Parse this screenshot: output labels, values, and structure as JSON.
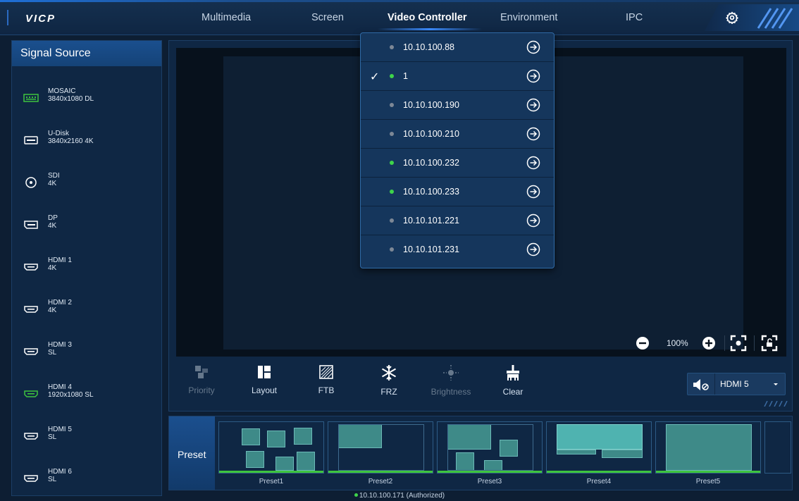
{
  "app": {
    "logo": "VICP"
  },
  "nav": {
    "items": [
      {
        "label": "Multimedia",
        "active": false
      },
      {
        "label": "Screen",
        "active": false
      },
      {
        "label": "Video Controller",
        "active": true
      },
      {
        "label": "Environment",
        "active": false
      },
      {
        "label": "IPC",
        "active": false
      }
    ],
    "settings_icon": "gear-icon"
  },
  "sidebar": {
    "title": "Signal Source",
    "items": [
      {
        "name": "MOSAIC",
        "res": "3840x1080 DL",
        "icon": "mosaic-icon",
        "active": true
      },
      {
        "name": "U-Disk",
        "res": "3840x2160 4K",
        "icon": "usb-icon",
        "active": false
      },
      {
        "name": "SDI",
        "res": "4K",
        "icon": "sdi-icon",
        "active": false
      },
      {
        "name": "DP",
        "res": "4K",
        "icon": "dp-icon",
        "active": false
      },
      {
        "name": "HDMI 1",
        "res": "4K",
        "icon": "hdmi-icon",
        "active": false
      },
      {
        "name": "HDMI 2",
        "res": "4K",
        "icon": "hdmi-icon",
        "active": false
      },
      {
        "name": "HDMI 3",
        "res": "SL",
        "icon": "hdmi-icon",
        "active": false
      },
      {
        "name": "HDMI 4",
        "res": "1920x1080 SL",
        "icon": "hdmi-icon",
        "active": true
      },
      {
        "name": "HDMI 5",
        "res": "SL",
        "icon": "hdmi-icon",
        "active": false
      },
      {
        "name": "HDMI 6",
        "res": "SL",
        "icon": "hdmi-icon",
        "active": false
      }
    ]
  },
  "canvas": {
    "zoom": "100%"
  },
  "toolbar": {
    "tools": [
      {
        "label": "Priority",
        "icon": "priority-icon",
        "enabled": false
      },
      {
        "label": "Layout",
        "icon": "layout-icon",
        "enabled": true
      },
      {
        "label": "FTB",
        "icon": "ftb-icon",
        "enabled": true
      },
      {
        "label": "FRZ",
        "icon": "snowflake-icon",
        "enabled": true
      },
      {
        "label": "Brightness",
        "icon": "brightness-icon",
        "enabled": false
      },
      {
        "label": "Clear",
        "icon": "clear-icon",
        "enabled": true
      }
    ],
    "audio_source": "HDMI 5"
  },
  "presets": {
    "label": "Preset",
    "items": [
      "Preset1",
      "Preset2",
      "Preset3",
      "Preset4",
      "Preset5"
    ]
  },
  "status": {
    "text": "10.10.100.171 (Authorized)",
    "dot_color": "#3ed44a"
  },
  "device_dropdown": {
    "devices": [
      {
        "ip": "10.10.100.88",
        "online": false,
        "selected": false
      },
      {
        "ip": "1",
        "online": true,
        "selected": true
      },
      {
        "ip": "10.10.100.190",
        "online": false,
        "selected": false
      },
      {
        "ip": "10.10.100.210",
        "online": false,
        "selected": false
      },
      {
        "ip": "10.10.100.232",
        "online": true,
        "selected": false
      },
      {
        "ip": "10.10.100.233",
        "online": true,
        "selected": false
      },
      {
        "ip": "10.10.101.221",
        "online": false,
        "selected": false
      },
      {
        "ip": "10.10.101.231",
        "online": false,
        "selected": false
      }
    ],
    "online_color": "#3ed44a",
    "offline_color": "#7d8896"
  }
}
